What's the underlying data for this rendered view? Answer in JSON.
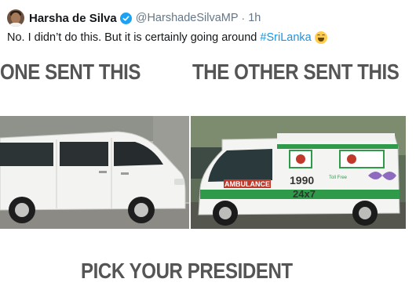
{
  "tweet": {
    "author_name": "Harsha de Silva",
    "handle": "@HarshadeSilvaMP",
    "separator": "·",
    "time": "1h",
    "text_main": "No. I didn’t do this. But it is certainly going around ",
    "hashtag": "#SriLanka",
    "emoji": "grinning-squinting-face",
    "verified_color": "#1da1f2",
    "link_color": "#1b95e0"
  },
  "media": {
    "caption_left": "ONE SENT THIS",
    "caption_right": "THE OTHER SENT THIS",
    "caption_bottom": "PICK YOUR PRESIDENT",
    "ambulance": {
      "label": "AMBULANCE",
      "number": "1990",
      "hours": "24x7",
      "toll_free": "Toll Free"
    },
    "left_image": "white-van",
    "right_image": "ambulance-van"
  }
}
